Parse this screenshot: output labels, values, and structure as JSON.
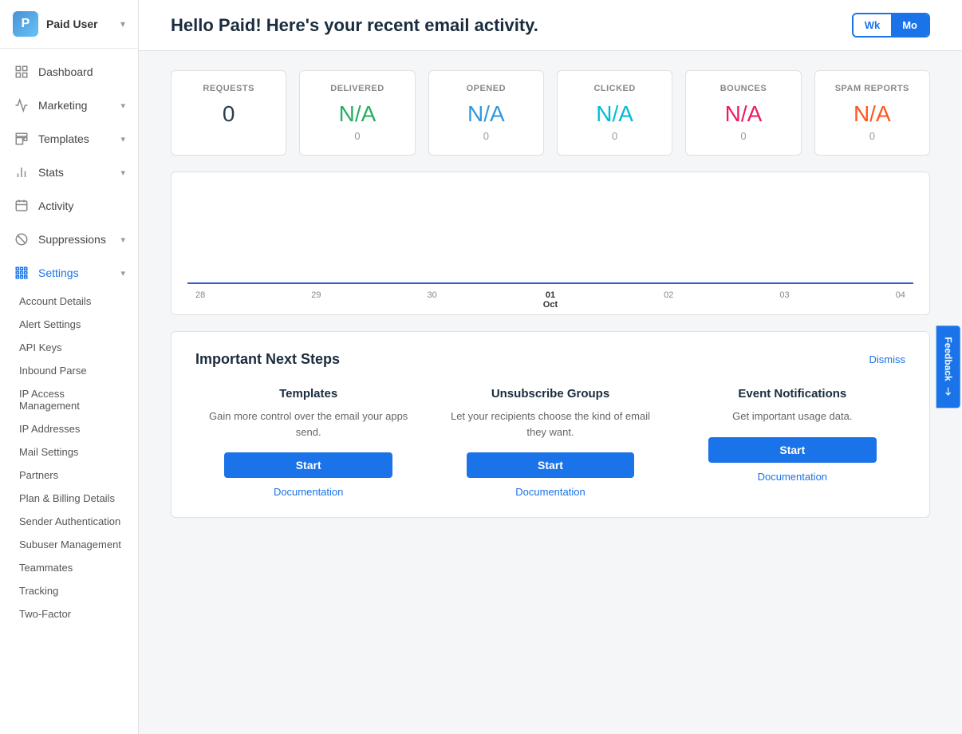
{
  "sidebar": {
    "user_label": "Paid User",
    "items": [
      {
        "id": "dashboard",
        "label": "Dashboard",
        "icon": "🏠",
        "has_chevron": false
      },
      {
        "id": "marketing",
        "label": "Marketing",
        "icon": "📢",
        "has_chevron": true
      },
      {
        "id": "templates",
        "label": "Templates",
        "icon": "📋",
        "has_chevron": true
      },
      {
        "id": "stats",
        "label": "Stats",
        "icon": "📊",
        "has_chevron": true
      },
      {
        "id": "activity",
        "label": "Activity",
        "icon": "📨",
        "has_chevron": false
      },
      {
        "id": "suppressions",
        "label": "Suppressions",
        "icon": "🚫",
        "has_chevron": true
      },
      {
        "id": "settings",
        "label": "Settings",
        "icon": "⚙️",
        "has_chevron": true,
        "active": true
      }
    ],
    "sub_items": [
      "Account Details",
      "Alert Settings",
      "API Keys",
      "Inbound Parse",
      "IP Access Management",
      "IP Addresses",
      "Mail Settings",
      "Partners",
      "Plan & Billing Details",
      "Sender Authentication",
      "Subuser Management",
      "Teammates",
      "Tracking",
      "Two-Factor"
    ]
  },
  "header": {
    "title": "Hello Paid! Here's your recent email activity.",
    "period_wk": "Wk",
    "period_mo": "Mo"
  },
  "stats": [
    {
      "label": "REQUESTS",
      "value": "0",
      "sub": "",
      "color_class": "color-requests"
    },
    {
      "label": "DELIVERED",
      "value": "N/A",
      "sub": "0",
      "color_class": "color-delivered"
    },
    {
      "label": "OPENED",
      "value": "N/A",
      "sub": "0",
      "color_class": "color-opened"
    },
    {
      "label": "CLICKED",
      "value": "N/A",
      "sub": "0",
      "color_class": "color-clicked"
    },
    {
      "label": "BOUNCES",
      "value": "N/A",
      "sub": "0",
      "color_class": "color-bounces"
    },
    {
      "label": "SPAM REPORTS",
      "value": "N/A",
      "sub": "0",
      "color_class": "color-spam"
    }
  ],
  "chart": {
    "labels": [
      "28",
      "29",
      "30",
      "01",
      "02",
      "03",
      "04"
    ],
    "highlight_label": "Oct",
    "highlight_index": 3
  },
  "next_steps": {
    "title": "Important Next Steps",
    "dismiss_label": "Dismiss",
    "cards": [
      {
        "title": "Templates",
        "desc": "Gain more control over the email your apps send.",
        "start_label": "Start",
        "doc_label": "Documentation"
      },
      {
        "title": "Unsubscribe Groups",
        "desc": "Let your recipients choose the kind of email they want.",
        "start_label": "Start",
        "doc_label": "Documentation"
      },
      {
        "title": "Event Notifications",
        "desc": "Get important usage data.",
        "start_label": "Start",
        "doc_label": "Documentation"
      }
    ]
  },
  "feedback": {
    "label": "Feedback"
  }
}
